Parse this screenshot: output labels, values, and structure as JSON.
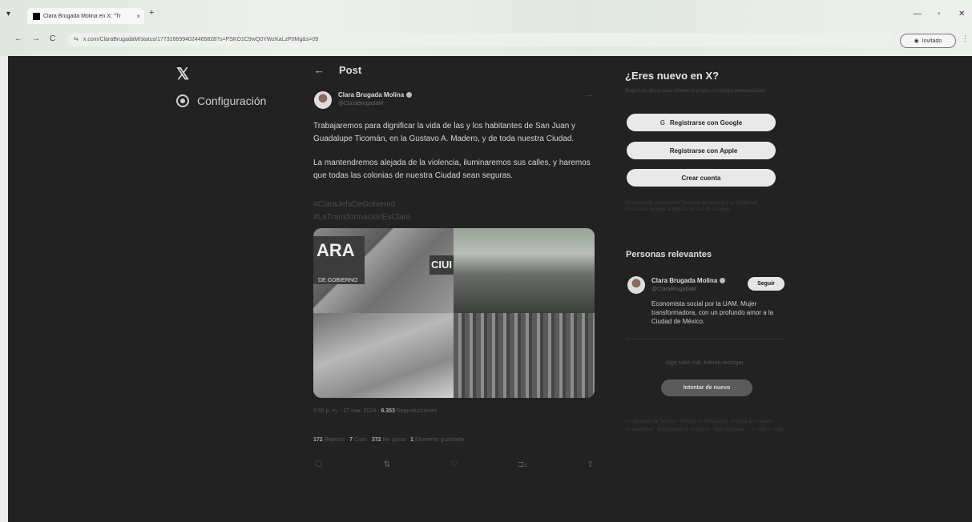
{
  "browser": {
    "tab_title": "Clara Brugada Molina en X: \"Tr",
    "tab_close": "×",
    "new_tab": "+",
    "minimize": "—",
    "restore": "▫",
    "close": "✕",
    "back": "←",
    "forward": "→",
    "reload": "C",
    "url": "x.com/ClaraBrugadaM/status/1773166994024465828?s=PSKO1C9wQ0YWzKaLzP0Mg&s=09",
    "guest_label": "Invitado",
    "menu": "⋮"
  },
  "sidebar": {
    "logo": "𝕏",
    "settings_label": "Configuración"
  },
  "post": {
    "header": "Post",
    "back": "←",
    "author_name": "Clara Brugada Molina",
    "author_handle": "@ClaraBrugadaM",
    "more": "···",
    "paragraph1": "Trabajaremos para dignificar la vida de las y los habitantes de San Juan y Guadalupe Ticomán, en la Gustavo A. Madero, y de toda nuestra Ciudad.",
    "paragraph2": "La mantendremos alejada de la violencia, iluminaremos sus calles, y haremos que todas las colonias de nuestra Ciudad sean seguras.",
    "hashtag1": "#ClaraJefaDeGobierno",
    "hashtag2": "#LaTransformaciónEsClara",
    "media_text_1": "ARA",
    "media_text_2": "DE GOBIERNO",
    "media_text_3": "CIUI",
    "time": "3:55 p. m. · 27 mar. 2024",
    "views_count": "6.353",
    "views_label": "Reproducciones",
    "reposts_count": "172",
    "reposts_label": "Reposts",
    "quotes_count": "7",
    "quotes_label": "Citas",
    "likes_count": "372",
    "likes_label": "Me gusta",
    "bookmarks_count": "1",
    "bookmarks_label": "Elemento guardado",
    "actions": {
      "reply": "🗨",
      "repost": "⇅",
      "like": "♡",
      "bookmark": "⊐",
      "bookmark_count": "1",
      "share": "⇪"
    }
  },
  "right": {
    "title": "¿Eres nuevo en X?",
    "subtitle": "Regístrate ahora para obtener tu propia cronología personalizada.",
    "google_btn": "Registrarse con Google",
    "google_icon": "G",
    "apple_btn": "Registrarse con Apple",
    "apple_icon": "",
    "create_btn": "Crear cuenta",
    "legal": "Al registrarte, aceptas los Términos de servicio y la Política de privacidad, incluida la política de Uso de Cookies.",
    "relevant_title": "Personas relevantes",
    "person_name": "Clara Brugada Molina",
    "person_handle": "@ClaraBrugadaM",
    "follow_btn": "Seguir",
    "bio": "Economista social por la UAM. Mujer transformadora, con un profundo amor a la Ciudad de México.",
    "error_text": "Algo salió mal. Intenta recargar.",
    "retry_btn": "Intentar de nuevo",
    "footer": "Condiciones de Servicio · Política de Privacidad · Política de cookies · Accesibilidad · Información de anuncios · Más opciones ··· © 2024 X Corp."
  }
}
